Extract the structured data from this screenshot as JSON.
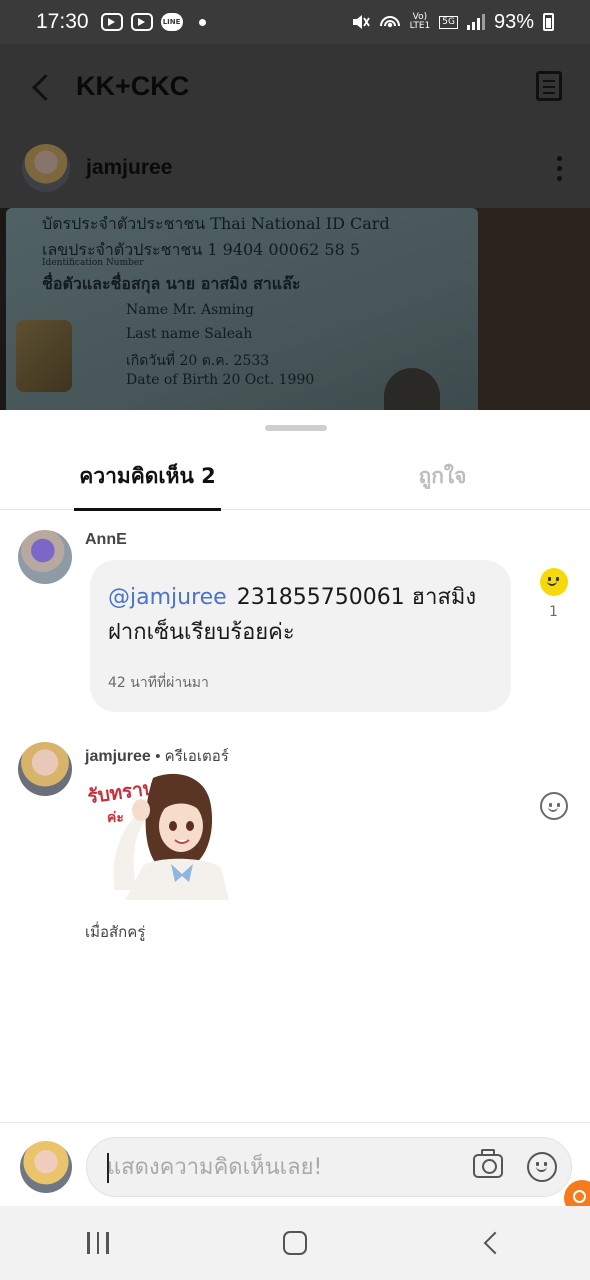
{
  "status_bar": {
    "time": "17:30",
    "line_badge": "LINE",
    "volte": "Vo)",
    "lte": "LTE1",
    "net": "5G",
    "battery": "93%"
  },
  "header": {
    "title": "KK+CKC",
    "author_name": "jamjuree"
  },
  "post_image": {
    "card_lines": [
      "บัตรประจำตัวประชาชน Thai National ID Card",
      "เลขประจำตัวประชาชน     1 9404 00062 58 5",
      "Identification Number",
      "ชื่อตัวและชื่อสกุล  นาย  อาสมิง  สาแล๊ะ",
      "Name   Mr. Asming",
      "Last name   Saleah",
      "เกิดวันที่   20 ต.ค. 2533",
      "Date of Birth  20 Oct. 1990"
    ]
  },
  "tabs": [
    {
      "label": "ความคิดเห็น 2"
    },
    {
      "label": "ถูกใจ"
    }
  ],
  "comments": [
    {
      "author": "AnnE",
      "mention": "@jamjuree",
      "text": "231855750061 ฮาสมิง ฝากเซ็นเรียบร้อยค่ะ",
      "time": "42 นาทีที่ผ่านมา",
      "reaction_count": "1",
      "reaction_color": "#f6d90a"
    },
    {
      "author": "jamjuree",
      "creator_tag": "• ครีเอเตอร์",
      "sticker_text": "รับทราบ",
      "sticker_text2": "ค่ะ",
      "time": "เมื่อสักครู่"
    }
  ],
  "composer": {
    "placeholder": "แสดงความคิดเห็นเลย!"
  },
  "colors": {
    "mention": "#4a74c9",
    "accent_fab": "#f57b1f"
  }
}
